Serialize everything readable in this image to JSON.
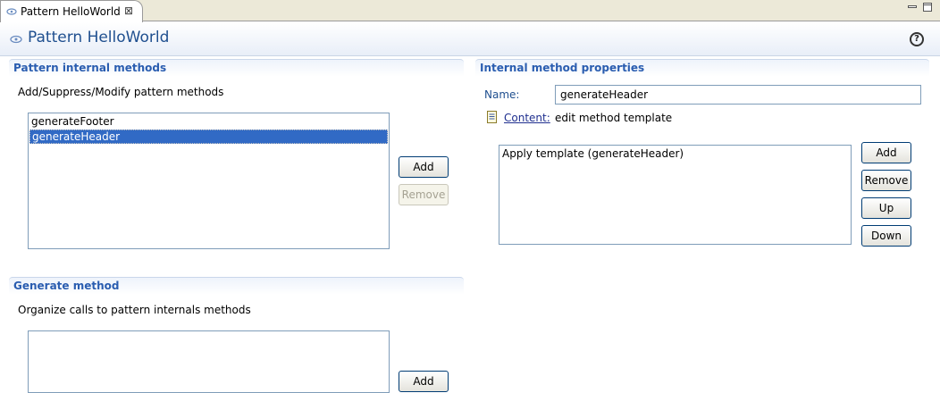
{
  "tab": {
    "label": "Pattern HelloWorld",
    "close": "⊠"
  },
  "form": {
    "title": "Pattern HelloWorld",
    "help": "?"
  },
  "internal_methods": {
    "title": "Pattern internal methods",
    "description": "Add/Suppress/Modify pattern methods",
    "items": [
      {
        "label": "generateFooter",
        "selected": false
      },
      {
        "label": "generateHeader",
        "selected": true
      }
    ],
    "add_label": "Add",
    "remove_label": "Remove"
  },
  "generate_method": {
    "title": "Generate method",
    "description": "Organize calls to pattern internals methods",
    "add_label": "Add"
  },
  "properties": {
    "title": "Internal method properties",
    "name_label": "Name:",
    "name_value": "generateHeader",
    "content_link": "Content:",
    "content_text": "edit method template",
    "items": [
      {
        "label": "Apply template (generateHeader)"
      }
    ],
    "add_label": "Add",
    "remove_label": "Remove",
    "up_label": "Up",
    "down_label": "Down"
  }
}
